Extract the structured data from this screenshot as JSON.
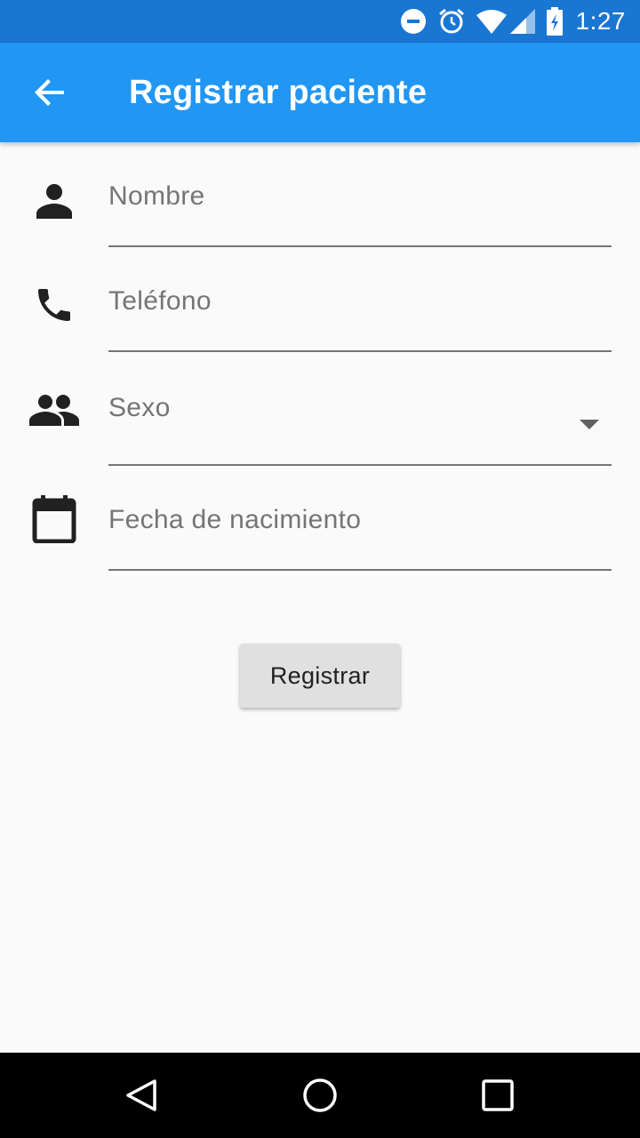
{
  "status_bar": {
    "time": "1:27",
    "icons": [
      "do-not-disturb-icon",
      "alarm-icon",
      "wifi-icon",
      "signal-icon",
      "battery-icon"
    ]
  },
  "app_bar": {
    "title": "Registrar paciente",
    "back_icon": "arrow-back-icon",
    "color": "#2196f3"
  },
  "form": {
    "fields": [
      {
        "icon": "person-icon",
        "placeholder": "Nombre"
      },
      {
        "icon": "phone-icon",
        "placeholder": "Teléfono"
      },
      {
        "icon": "people-icon",
        "placeholder": "Sexo",
        "type": "dropdown"
      },
      {
        "icon": "calendar-icon",
        "placeholder": "Fecha de nacimiento"
      }
    ],
    "submit_label": "Registrar"
  },
  "nav_bar": {
    "buttons": [
      "back-triangle-icon",
      "home-circle-icon",
      "recents-square-icon"
    ]
  }
}
